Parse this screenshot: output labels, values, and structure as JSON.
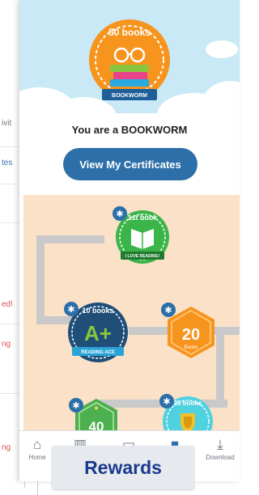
{
  "background_app": {
    "fragments": [
      "ivit",
      "tes",
      "ed!",
      "ng",
      "ng"
    ]
  },
  "top_badge": {
    "count_label": "50 books",
    "ribbon": "BOOKWORM"
  },
  "status_text": "You are a BOOKWORM",
  "certificates_button": "View My Certificates",
  "map_badges": [
    {
      "title": "1st book",
      "ribbon": "I LOVE READING!"
    },
    {
      "title": "10 books",
      "center": "A+",
      "ribbon": "READING ACE"
    },
    {
      "center": "20",
      "ribbon": "Books"
    },
    {
      "center": "40"
    },
    {
      "title": "30 books"
    }
  ],
  "nav": {
    "items": [
      {
        "label": "Home",
        "icon": "home-icon"
      },
      {
        "label": "",
        "icon": "library-icon"
      },
      {
        "label": "",
        "icon": "briefcase-icon"
      },
      {
        "label": "",
        "icon": "rewards-icon"
      },
      {
        "label": "Download",
        "icon": "download-icon"
      }
    ]
  },
  "caption": "Rewards",
  "colors": {
    "primary": "#2d6fa8",
    "sky": "#c8e9f5",
    "map_bg": "#fbe1c7",
    "caption_text": "#1a3a8f"
  }
}
